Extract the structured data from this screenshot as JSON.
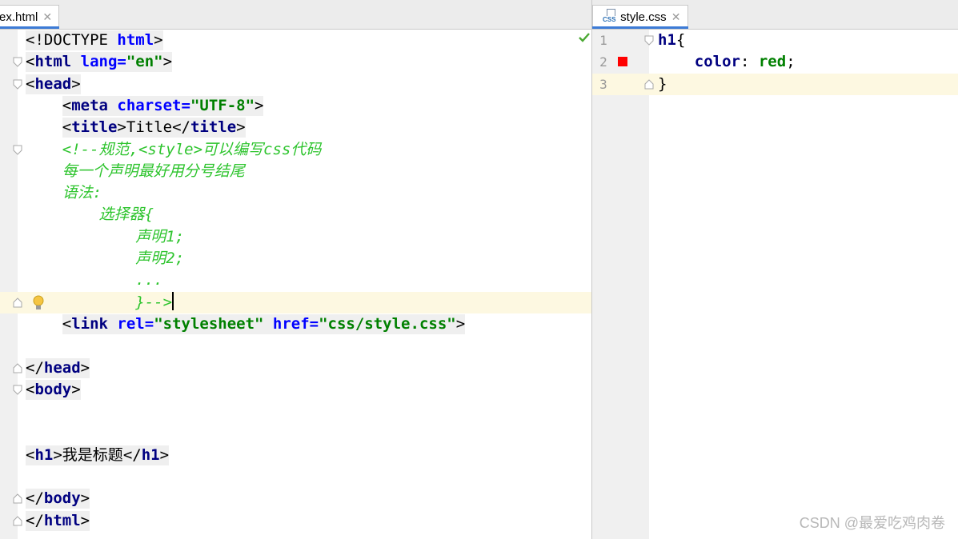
{
  "left_editor": {
    "tab": {
      "label": "ex.html",
      "close": "✕"
    },
    "lines": [
      {
        "parts": [
          {
            "text": "<!DOCTYPE ",
            "cls": "t-default"
          },
          {
            "text": "html",
            "cls": "t-attr"
          },
          {
            "text": ">",
            "cls": "t-default"
          }
        ],
        "bg": true,
        "fold": "none"
      },
      {
        "parts": [
          {
            "text": "<",
            "cls": "t-default"
          },
          {
            "text": "html ",
            "cls": "t-tag"
          },
          {
            "text": "lang=",
            "cls": "t-attr"
          },
          {
            "text": "\"en\"",
            "cls": "t-str"
          },
          {
            "text": ">",
            "cls": "t-default"
          }
        ],
        "bg": true,
        "fold": "open"
      },
      {
        "parts": [
          {
            "text": "<",
            "cls": "t-default"
          },
          {
            "text": "head",
            "cls": "t-tag"
          },
          {
            "text": ">",
            "cls": "t-default"
          }
        ],
        "bg": true,
        "fold": "open"
      },
      {
        "parts": [
          {
            "text": "    ",
            "cls": "t-default",
            "plain": true
          },
          {
            "text": "<",
            "cls": "t-default"
          },
          {
            "text": "meta ",
            "cls": "t-tag"
          },
          {
            "text": "charset=",
            "cls": "t-attr"
          },
          {
            "text": "\"UTF-8\"",
            "cls": "t-str"
          },
          {
            "text": ">",
            "cls": "t-default"
          }
        ],
        "bg": true,
        "fold": "none"
      },
      {
        "parts": [
          {
            "text": "    ",
            "cls": "t-default",
            "plain": true
          },
          {
            "text": "<",
            "cls": "t-default"
          },
          {
            "text": "title",
            "cls": "t-tag"
          },
          {
            "text": ">",
            "cls": "t-default"
          },
          {
            "text": "Title",
            "cls": "t-default"
          },
          {
            "text": "</",
            "cls": "t-default"
          },
          {
            "text": "title",
            "cls": "t-tag"
          },
          {
            "text": ">",
            "cls": "t-default"
          }
        ],
        "bg": true,
        "fold": "none"
      },
      {
        "parts": [
          {
            "text": "    <!--规范,<style>可以编写css代码",
            "cls": "t-comment",
            "plain": true
          }
        ],
        "bg": false,
        "fold": "open"
      },
      {
        "parts": [
          {
            "text": "    每一个声明最好用分号结尾",
            "cls": "t-comment",
            "plain": true
          }
        ],
        "bg": false,
        "fold": "none"
      },
      {
        "parts": [
          {
            "text": "    语法:",
            "cls": "t-comment",
            "plain": true
          }
        ],
        "bg": false,
        "fold": "none"
      },
      {
        "parts": [
          {
            "text": "        选择器{",
            "cls": "t-comment",
            "plain": true
          }
        ],
        "bg": false,
        "fold": "none"
      },
      {
        "parts": [
          {
            "text": "            声明1;",
            "cls": "t-comment",
            "plain": true
          }
        ],
        "bg": false,
        "fold": "none"
      },
      {
        "parts": [
          {
            "text": "            声明2;",
            "cls": "t-comment",
            "plain": true
          }
        ],
        "bg": false,
        "fold": "none"
      },
      {
        "parts": [
          {
            "text": "            ...",
            "cls": "t-comment",
            "plain": true
          }
        ],
        "bg": false,
        "fold": "none"
      },
      {
        "parts": [
          {
            "text": "            }-->",
            "cls": "t-comment",
            "plain": true
          }
        ],
        "bg": false,
        "fold": "close",
        "current": true,
        "bulb": true
      },
      {
        "parts": [
          {
            "text": "    ",
            "cls": "t-default",
            "plain": true
          },
          {
            "text": "<",
            "cls": "t-default"
          },
          {
            "text": "link ",
            "cls": "t-tag"
          },
          {
            "text": "rel=",
            "cls": "t-attr"
          },
          {
            "text": "\"stylesheet\" ",
            "cls": "t-str"
          },
          {
            "text": "href=",
            "cls": "t-attr"
          },
          {
            "text": "\"css/style.css\"",
            "cls": "t-str"
          },
          {
            "text": ">",
            "cls": "t-default"
          }
        ],
        "bg": true,
        "fold": "none"
      },
      {
        "parts": [],
        "bg": false,
        "fold": "none"
      },
      {
        "parts": [
          {
            "text": "</",
            "cls": "t-default"
          },
          {
            "text": "head",
            "cls": "t-tag"
          },
          {
            "text": ">",
            "cls": "t-default"
          }
        ],
        "bg": true,
        "fold": "close"
      },
      {
        "parts": [
          {
            "text": "<",
            "cls": "t-default"
          },
          {
            "text": "body",
            "cls": "t-tag"
          },
          {
            "text": ">",
            "cls": "t-default"
          }
        ],
        "bg": true,
        "fold": "open"
      },
      {
        "parts": [],
        "bg": false,
        "fold": "none"
      },
      {
        "parts": [],
        "bg": false,
        "fold": "none"
      },
      {
        "parts": [
          {
            "text": "<",
            "cls": "t-default"
          },
          {
            "text": "h1",
            "cls": "t-tag"
          },
          {
            "text": ">",
            "cls": "t-default"
          },
          {
            "text": "我是标题",
            "cls": "t-default"
          },
          {
            "text": "</",
            "cls": "t-default"
          },
          {
            "text": "h1",
            "cls": "t-tag"
          },
          {
            "text": ">",
            "cls": "t-default"
          }
        ],
        "bg": true,
        "fold": "none"
      },
      {
        "parts": [],
        "bg": false,
        "fold": "none"
      },
      {
        "parts": [
          {
            "text": "</",
            "cls": "t-default"
          },
          {
            "text": "body",
            "cls": "t-tag"
          },
          {
            "text": ">",
            "cls": "t-default"
          }
        ],
        "bg": true,
        "fold": "close"
      },
      {
        "parts": [
          {
            "text": "</",
            "cls": "t-default"
          },
          {
            "text": "html",
            "cls": "t-tag"
          },
          {
            "text": ">",
            "cls": "t-default"
          }
        ],
        "bg": true,
        "fold": "close"
      }
    ],
    "status_icon": "checkmark-icon",
    "status_color": "#4aa832"
  },
  "right_editor": {
    "tab": {
      "label": "style.css",
      "icon_text": "CSS",
      "close": "✕"
    },
    "lines": [
      {
        "number": "1",
        "parts": [
          {
            "text": "h1",
            "cls": "t-sel"
          },
          {
            "text": "{",
            "cls": "t-default"
          }
        ],
        "fold": "open"
      },
      {
        "number": "2",
        "parts": [
          {
            "text": "    ",
            "cls": "t-default"
          },
          {
            "text": "color",
            "cls": "t-prop"
          },
          {
            "text": ": ",
            "cls": "t-default"
          },
          {
            "text": "red",
            "cls": "t-val"
          },
          {
            "text": ";",
            "cls": "t-default"
          }
        ],
        "fold": "none",
        "swatch": "#ff0000"
      },
      {
        "number": "3",
        "parts": [
          {
            "text": "}",
            "cls": "t-default"
          }
        ],
        "fold": "close",
        "current": true
      }
    ]
  },
  "watermark": "CSDN @最爱吃鸡肉卷"
}
